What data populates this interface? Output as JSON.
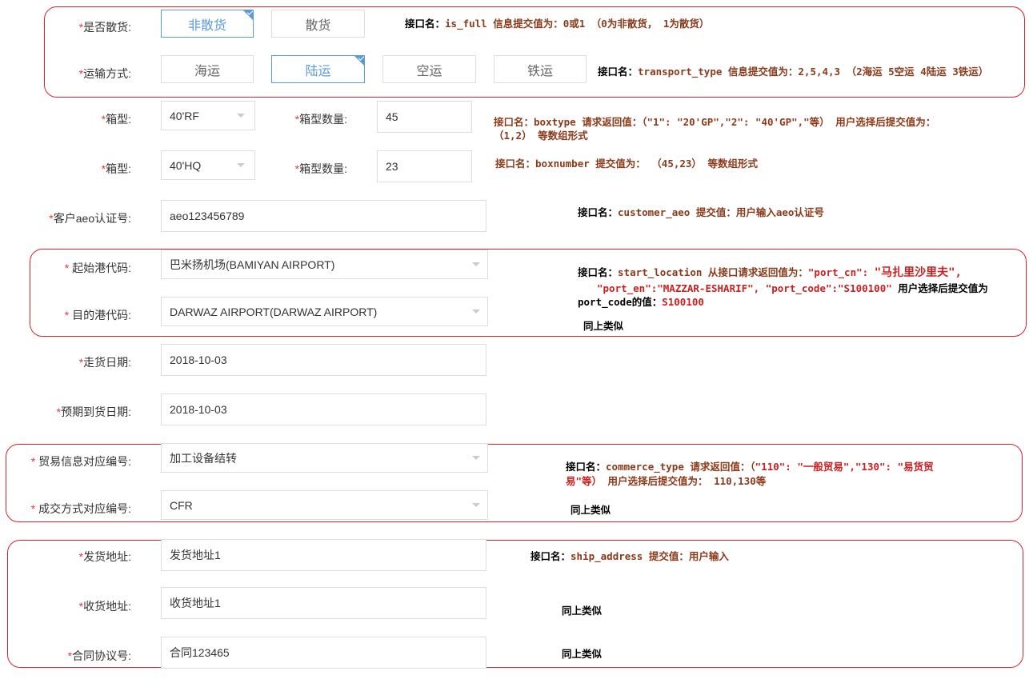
{
  "form": {
    "bulk": {
      "label": "是否散货:",
      "options": [
        "非散货",
        "散货"
      ],
      "selected_index": 0
    },
    "transport": {
      "label": "运输方式:",
      "options": [
        "海运",
        "陆运",
        "空运",
        "铁运"
      ],
      "selected_index": 1
    },
    "box_rows": [
      {
        "type_label": "箱型:",
        "type_value": "40'RF",
        "count_label": "箱型数量:",
        "count_value": "45"
      },
      {
        "type_label": "箱型:",
        "type_value": "40'HQ",
        "count_label": "箱型数量:",
        "count_value": "23"
      }
    ],
    "customer_aeo": {
      "label": "客户aeo认证号:",
      "value": "aeo123456789"
    },
    "start_port": {
      "label": " 起始港代码:",
      "value": "巴米扬机场(BAMIYAN AIRPORT)"
    },
    "dest_port": {
      "label": " 目的港代码:",
      "value": "DARWAZ AIRPORT(DARWAZ AIRPORT)"
    },
    "ship_date": {
      "label": "走货日期:",
      "value": "2018-10-03"
    },
    "expected_date": {
      "label": "预期到货日期:",
      "value": "2018-10-03"
    },
    "trade_code": {
      "label": " 贸易信息对应编号:",
      "value": "加工设备结转"
    },
    "deal_code": {
      "label": " 成交方式对应编号:",
      "value": "CFR"
    },
    "ship_address": {
      "label": "发货地址:",
      "value": "发货地址1"
    },
    "recv_address": {
      "label": "收货地址:",
      "value": "收货地址1"
    },
    "contract_no": {
      "label": "合同协议号:",
      "value": "合同123465"
    },
    "required_mark": "*"
  },
  "notes": {
    "is_full": {
      "key": "接口名：",
      "name": "is_full",
      "desc": "  信息提交值为：0或1 （0为非散货， 1为散货）"
    },
    "transport_type": {
      "key": "接口名：",
      "name": "transport_type",
      "desc": "  信息提交值为：2,5,4,3 （2海运 5空运 4陆运 3铁运）"
    },
    "boxtype_1": {
      "key": "接口名：",
      "name": "boxtype",
      "desc": "  请求返回值：（\"1\": \"20'GP\",\"2\": \"40'GP\",\"等）  用户选择后提交值为："
    },
    "boxtype_2": "（1,2） 等数组形式",
    "boxnumber": {
      "key": "接口名：",
      "name": "boxnumber",
      "desc": " 提交值为： （45,23） 等数组形式"
    },
    "customer_aeo": {
      "key": "接口名：",
      "name": "customer_aeo",
      "desc": "    提交值：用户输入aeo认证号"
    },
    "start_location_1": {
      "key": "接口名：",
      "name": "start_location",
      "desc": "  从接口请求返回值为：",
      "q1": "\"port_cn\": ",
      "q1v": "\"马扎里沙里夫\","
    },
    "start_location_2": {
      "q2": "\"port_en\":\"MAZZAR-ESHARIF\", \"port_code\":\"S100100\"",
      "tail": "  用户选择后提交值为"
    },
    "start_location_3": {
      "pre": "port_code的值：",
      "val": "S100100"
    },
    "same_as_above": "同上类似",
    "commerce_type_1": {
      "key": "接口名：",
      "name": "commerce_type",
      "desc": "  请求返回值：（",
      "v": "\"110\": \"一般贸易\",\"130\": \"易货贸"
    },
    "commerce_type_2": {
      "v": "易\"等）",
      "tail": "  用户选择后提交值为：  110,130等"
    },
    "ship_address": {
      "key": "接口名：",
      "name": "ship_address",
      "desc": "  提交值：用户输入"
    }
  },
  "colors": {
    "frame": "#d9232e",
    "selected": "#5b9bd5",
    "required": "#e4393c"
  }
}
